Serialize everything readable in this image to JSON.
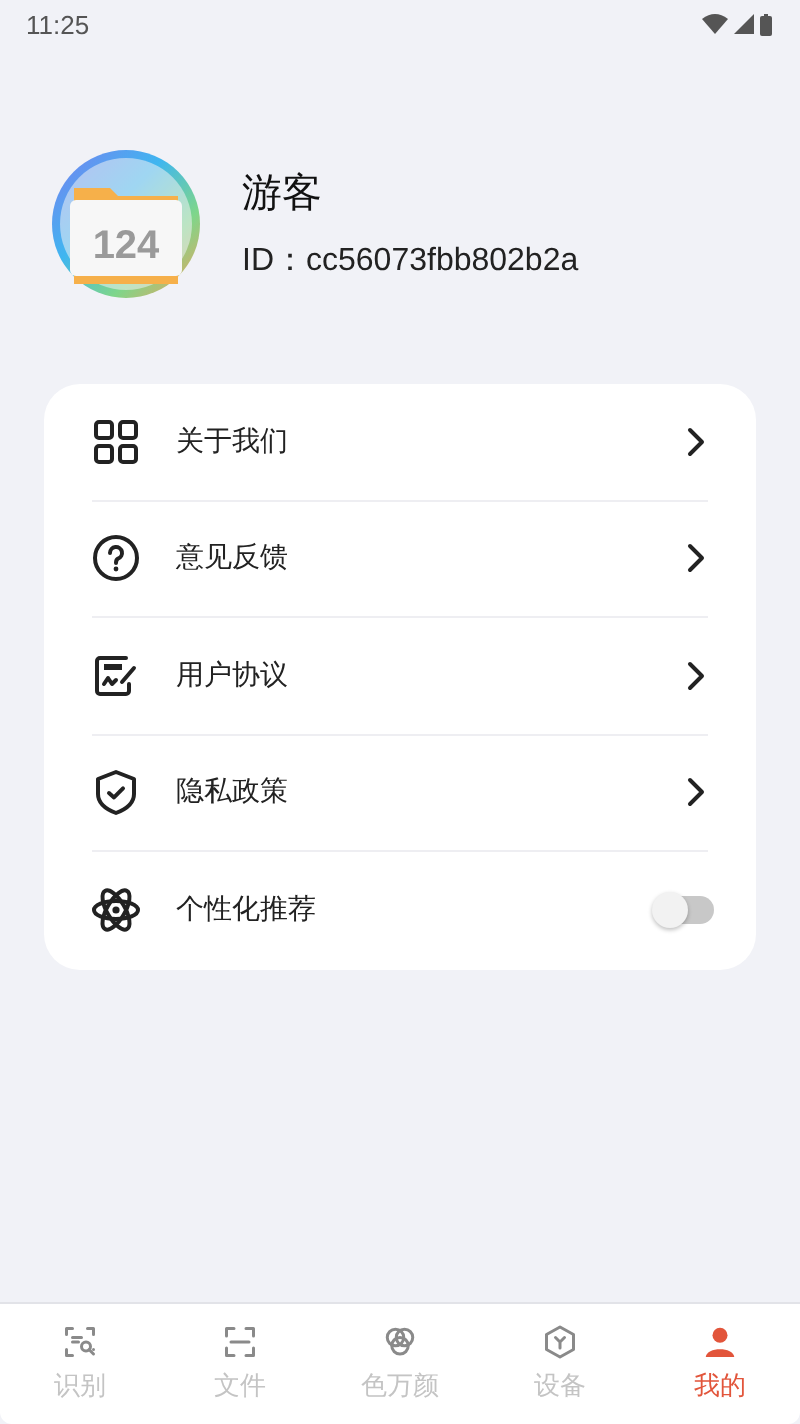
{
  "status_bar": {
    "time": "11:25"
  },
  "profile": {
    "avatar_text": "124",
    "name": "游客",
    "id": "ID：cc56073fbb802b2a"
  },
  "menu": [
    {
      "kind": "link",
      "label": "关于我们"
    },
    {
      "kind": "link",
      "label": "意见反馈"
    },
    {
      "kind": "link",
      "label": "用户协议"
    },
    {
      "kind": "link",
      "label": "隐私政策"
    },
    {
      "kind": "toggle",
      "label": "个性化推荐",
      "on": false
    }
  ],
  "tabs": [
    {
      "label": "识别",
      "selected": false
    },
    {
      "label": "文件",
      "selected": false
    },
    {
      "label": "色万颜",
      "selected": false
    },
    {
      "label": "设备",
      "selected": false
    },
    {
      "label": "我的",
      "selected": true
    }
  ]
}
